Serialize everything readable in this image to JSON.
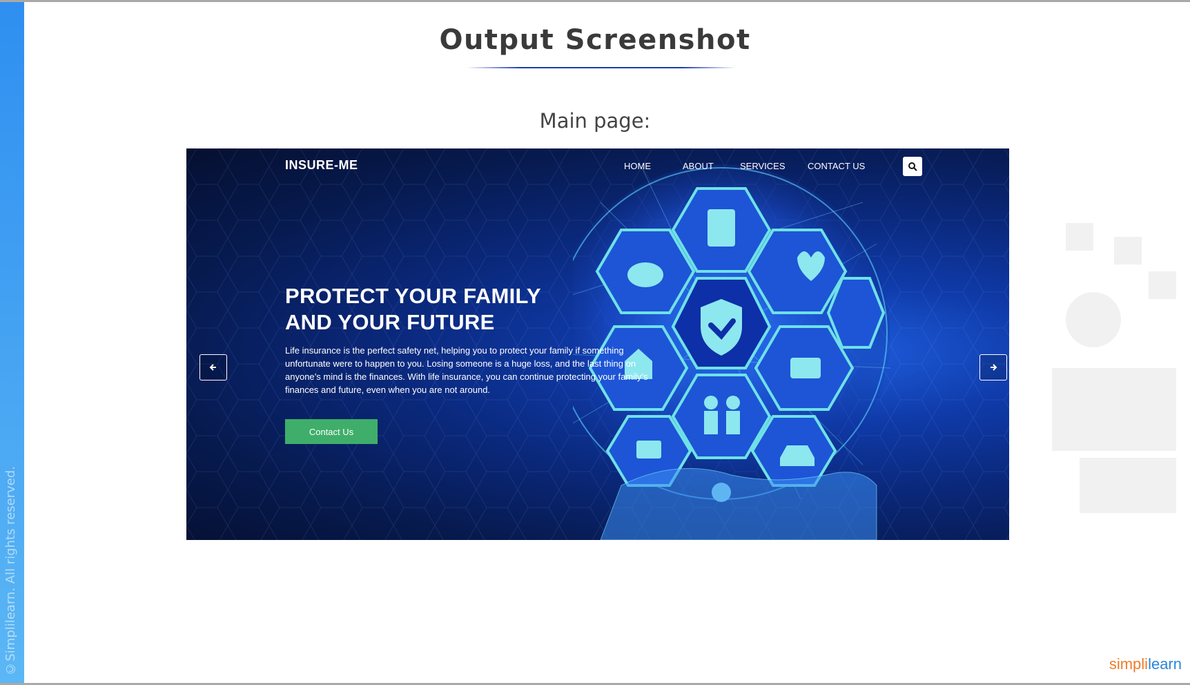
{
  "slide": {
    "title": "Output Screenshot",
    "subtitle": "Main page:",
    "copyright": "©Simplilearn. All rights reserved.",
    "footer_logo": {
      "part1": "simpli",
      "part2": "learn"
    }
  },
  "site": {
    "brand": "INSURE-ME",
    "nav": [
      "HOME",
      "ABOUT",
      "SERVICES",
      "CONTACT US"
    ],
    "search_icon": "search-icon",
    "hero": {
      "title_line1": "PROTECT YOUR FAMILY",
      "title_line2": "AND YOUR FUTURE",
      "text": "Life insurance is the perfect safety net, helping you to protect your family if something unfortunate were to happen to you. Losing someone is a huge loss, and the last thing on anyone’s mind is the finances. With life insurance, you can continue protecting your family’s finances and future, even when you are not around.",
      "cta_label": "Contact Us"
    },
    "colors": {
      "cta": "#3fae6a",
      "background": "#0a2778",
      "accent": "#1f5fe0"
    }
  }
}
